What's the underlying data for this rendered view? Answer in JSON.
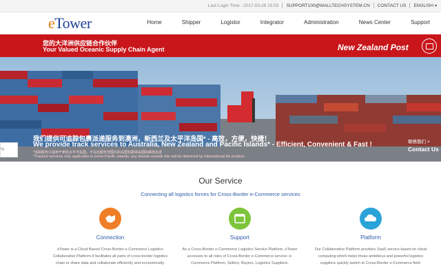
{
  "topbar": {
    "last_login": "Last Login Time : 2017-03-28 15:53",
    "email": "SUPPORT100@WALLTECHSYSTEM.CN",
    "contact": "CONTACT US",
    "language": "ENGLISH"
  },
  "logo": {
    "e": "e",
    "rest": "Tower"
  },
  "menu": [
    "Home",
    "Shipper",
    "Logistor",
    "Integrator",
    "Administration",
    "News Center",
    "Support"
  ],
  "banner": {
    "cn_heading": "您的大洋洲供应链合作伙伴",
    "en_heading": "Your Valued Oceanic Supply Chain Agent",
    "partner": "New Zealand Post",
    "cn_tagline": "我们提供可追踪包裹派递服务到澳洲，新西兰及太平洋岛国* - 高效，方便，快捷！",
    "en_tagline": "We provide track services to Australia, New Zealand and Pacific Islands* - Efficient, Convenient & Fast !",
    "note_cn": "*追踪服务只适用于某些太平洋岛国，不在此服务范围内的岛国包裹将由国际邮政派送",
    "note_en": "*Tracked services only applicable to some Pacific islands; any islands outside this will be delivered by International Air product",
    "contact_cn": "联络我们 >",
    "contact_en": "Contact Us",
    "input_value": "%"
  },
  "service": {
    "title": "Our Service",
    "subtitle": "Connecting all logistics forces for Cross-Border e-Commerce services",
    "items": [
      {
        "name": "Connection",
        "icon": "handshake-icon",
        "color": "#f07e26",
        "desc": "eTower is a Cloud Based Cross-Border e-Commerce Logistics Collaborative Platform.It facilitates all parts of cross-border logistics chain to share data and collaborate efficiently and economically."
      },
      {
        "name": "Support",
        "icon": "window-icon",
        "color": "#7cc43a",
        "desc": "As a Cross-Border e-Commerce Logistics Service Platform, eTower accesses to all roles of Cross-Border e-Commerce service: e-Commerce Platform, Sellers, Buyers, Logistics Suppliers."
      },
      {
        "name": "Platform",
        "icon": "cloud-icon",
        "color": "#2aa3d8",
        "desc": "Our Collaborative Platform provides SaaS service based on cloud computing which helps those ambitious and powerful logistics suppliers quickly switch to Cross-Border e-Commerce field."
      }
    ]
  }
}
